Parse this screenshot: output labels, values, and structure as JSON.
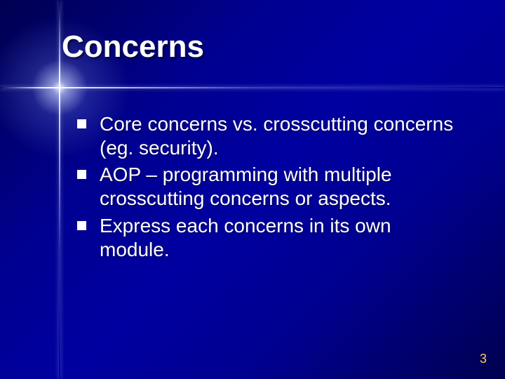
{
  "slide": {
    "title": "Concerns",
    "bullets": [
      "Core concerns vs. crosscutting concerns (eg. security).",
      "AOP – programming with multiple crosscutting concerns or aspects.",
      "Express each concerns in its own module."
    ],
    "page_number": "3"
  }
}
